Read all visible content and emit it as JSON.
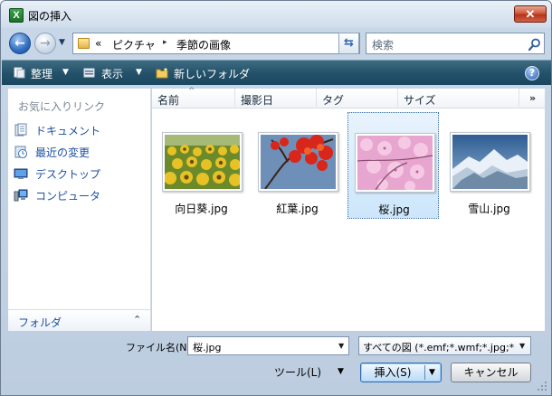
{
  "window": {
    "title": "図の挿入",
    "app_icon_letter": "X",
    "close_glyph": "✕"
  },
  "nav": {
    "back_glyph": "←",
    "forward_glyph": "→",
    "history_glyph": "▼",
    "address_prefix": "«",
    "breadcrumbs": [
      "ピクチャ",
      "季節の画像"
    ],
    "breadcrumb_sep": "▸",
    "address_dd_glyph": "▼",
    "refresh_glyph": "⇆"
  },
  "search": {
    "placeholder": "検索"
  },
  "toolbar": {
    "organize": "整理",
    "views": "表示",
    "new_folder": "新しいフォルダ",
    "caret": "▼",
    "help": "?"
  },
  "sidebar": {
    "title": "お気に入りリンク",
    "items": [
      {
        "label": "ドキュメント",
        "icon": "documents-icon"
      },
      {
        "label": "最近の変更",
        "icon": "recent-changes-icon"
      },
      {
        "label": "デスクトップ",
        "icon": "desktop-icon"
      },
      {
        "label": "コンピュータ",
        "icon": "computer-icon"
      }
    ],
    "folders_label": "フォルダ",
    "folders_caret": "⌃"
  },
  "columns": {
    "headers": [
      "名前",
      "撮影日",
      "タグ",
      "サイズ"
    ],
    "sort_glyph": "^",
    "more_glyph": "»"
  },
  "files": [
    {
      "name": "向日葵.jpg",
      "selected": false
    },
    {
      "name": "紅葉.jpg",
      "selected": false
    },
    {
      "name": "桜.jpg",
      "selected": true
    },
    {
      "name": "雪山.jpg",
      "selected": false
    }
  ],
  "footer": {
    "filename_label": "ファイル名(N):",
    "filename_value": "桜.jpg",
    "dd_glyph": "▼",
    "filetype_value": "すべての図 (*.emf;*.wmf;*.jpg;*.jpe",
    "tools_label": "ツール(L)",
    "tools_caret": "▼",
    "insert_label": "挿入(S)",
    "insert_dd_glyph": "▼",
    "cancel_label": "キャンセル"
  }
}
